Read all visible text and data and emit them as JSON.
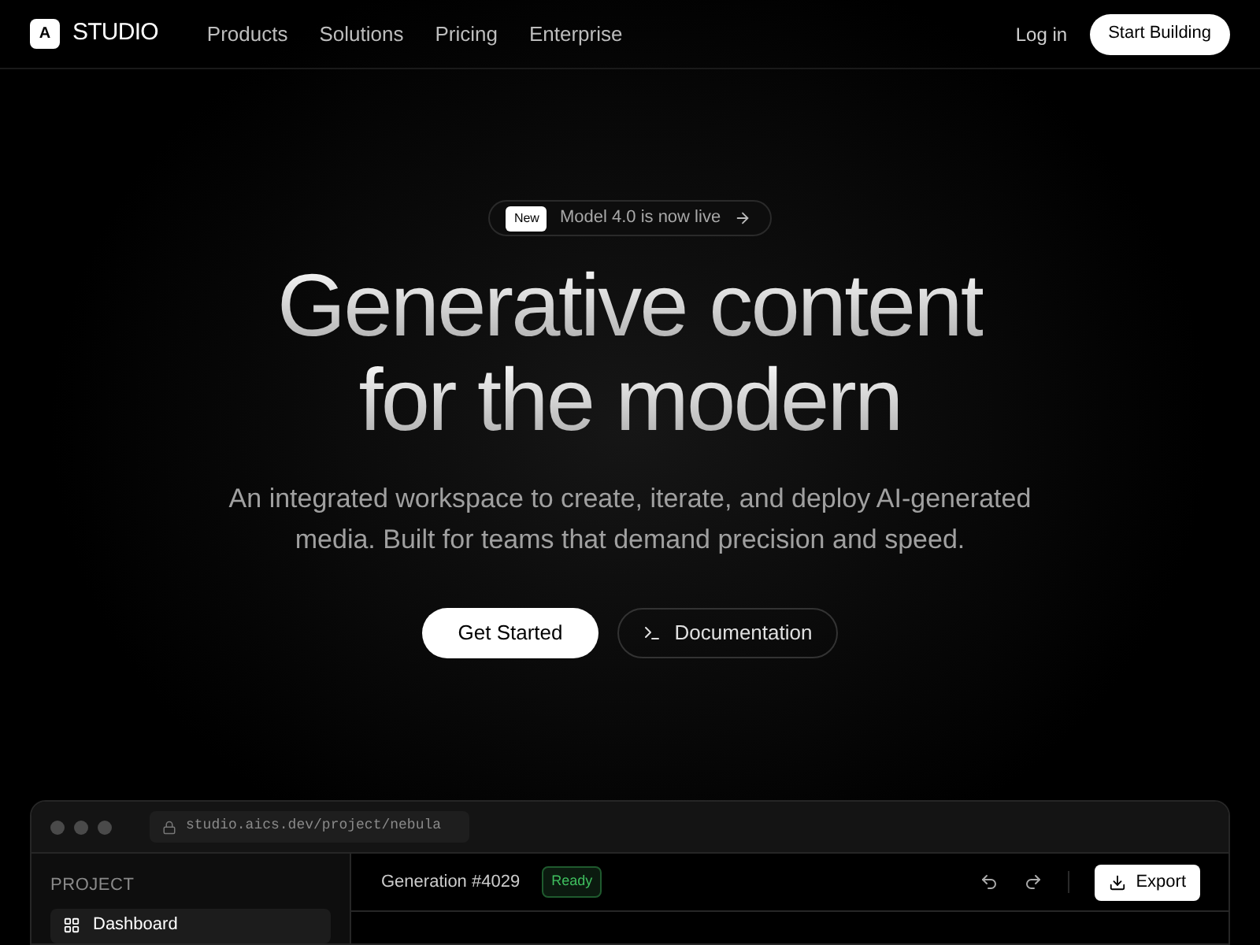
{
  "brand": {
    "logo_letter": "A",
    "name": "STUDIO"
  },
  "nav": {
    "links": [
      "Products",
      "Solutions",
      "Pricing",
      "Enterprise"
    ],
    "login": "Log in",
    "cta": "Start Building"
  },
  "hero": {
    "badge": {
      "tag": "New",
      "text": "Model 4.0 is now live"
    },
    "headline": [
      "Generative content",
      "for the modern"
    ],
    "subtitle": "An integrated workspace to create, iterate, and deploy AI-generated media. Built for teams that demand precision and speed.",
    "primary": "Get Started",
    "secondary": "Documentation"
  },
  "app": {
    "url": "studio.aics.dev/project/nebula",
    "sidebar": {
      "heading": "PROJECT",
      "items": [
        {
          "label": "Dashboard",
          "selected": true
        }
      ]
    },
    "toolbar": {
      "title": "Generation #4029",
      "status": "Ready",
      "export": "Export"
    }
  }
}
